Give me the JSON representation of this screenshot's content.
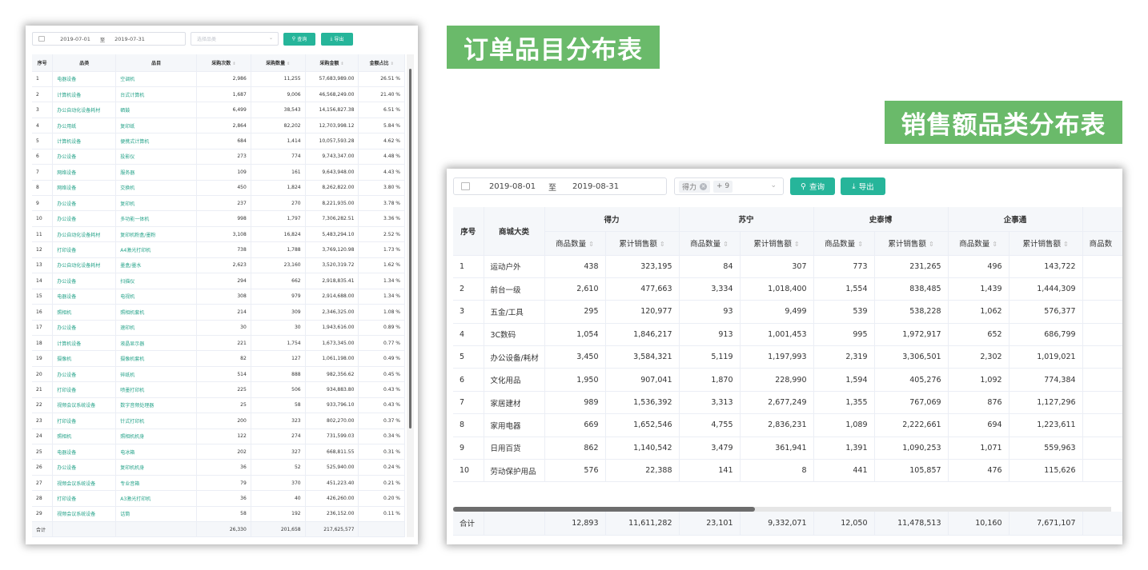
{
  "title1": "订单品目分布表",
  "title2": "销售额品类分布表",
  "left": {
    "date_start": "2019-07-01",
    "date_sep": "至",
    "date_end": "2019-07-31",
    "select_placeholder": "选择品类",
    "query_label": "查询",
    "export_label": "导出",
    "headers": [
      "序号",
      "品类",
      "品目",
      "采购次数",
      "采购数量",
      "采购金额",
      "金额占比"
    ],
    "rows": [
      [
        "1",
        "电器设备",
        "空调机",
        "2,986",
        "11,255",
        "57,683,989.00",
        "26.51 %"
      ],
      [
        "2",
        "计算机设备",
        "台式计算机",
        "1,687",
        "9,006",
        "46,568,249.00",
        "21.40 %"
      ],
      [
        "3",
        "办公自动化设备耗材",
        "硒鼓",
        "6,499",
        "38,543",
        "14,156,827.38",
        "6.51 %"
      ],
      [
        "4",
        "办公用纸",
        "复印纸",
        "2,864",
        "82,202",
        "12,703,998.12",
        "5.84 %"
      ],
      [
        "5",
        "计算机设备",
        "便携式计算机",
        "684",
        "1,414",
        "10,057,593.28",
        "4.62 %"
      ],
      [
        "6",
        "办公设备",
        "投影仪",
        "273",
        "774",
        "9,743,347.00",
        "4.48 %"
      ],
      [
        "7",
        "网络设备",
        "服务器",
        "109",
        "161",
        "9,643,948.00",
        "4.43 %"
      ],
      [
        "8",
        "网络设备",
        "交换机",
        "450",
        "1,824",
        "8,262,822.00",
        "3.80 %"
      ],
      [
        "9",
        "办公设备",
        "复印机",
        "237",
        "270",
        "8,221,935.00",
        "3.78 %"
      ],
      [
        "10",
        "办公设备",
        "多功能一体机",
        "998",
        "1,797",
        "7,306,282.51",
        "3.36 %"
      ],
      [
        "11",
        "办公自动化设备耗材",
        "复印机粉盒/墨粉",
        "3,108",
        "16,824",
        "5,483,294.10",
        "2.52 %"
      ],
      [
        "12",
        "打印设备",
        "A4激光打印机",
        "738",
        "1,788",
        "3,769,120.98",
        "1.73 %"
      ],
      [
        "13",
        "办公自动化设备耗材",
        "墨盒/墨水",
        "2,623",
        "23,160",
        "3,520,319.72",
        "1.62 %"
      ],
      [
        "14",
        "办公设备",
        "扫描仪",
        "294",
        "662",
        "2,918,835.41",
        "1.34 %"
      ],
      [
        "15",
        "电器设备",
        "电视机",
        "308",
        "979",
        "2,914,688.00",
        "1.34 %"
      ],
      [
        "16",
        "照相机",
        "照相机套机",
        "214",
        "309",
        "2,346,325.00",
        "1.08 %"
      ],
      [
        "17",
        "办公设备",
        "速印机",
        "30",
        "30",
        "1,943,616.00",
        "0.89 %"
      ],
      [
        "18",
        "计算机设备",
        "液晶显示器",
        "221",
        "1,754",
        "1,673,345.00",
        "0.77 %"
      ],
      [
        "19",
        "摄像机",
        "摄像机套机",
        "82",
        "127",
        "1,061,198.00",
        "0.49 %"
      ],
      [
        "20",
        "办公设备",
        "碎纸机",
        "514",
        "888",
        "982,356.62",
        "0.45 %"
      ],
      [
        "21",
        "打印设备",
        "喷墨打印机",
        "225",
        "506",
        "934,883.80",
        "0.43 %"
      ],
      [
        "22",
        "视频会议系统设备",
        "数字音频处理器",
        "25",
        "58",
        "933,796.10",
        "0.43 %"
      ],
      [
        "23",
        "打印设备",
        "针式打印机",
        "200",
        "323",
        "802,270.00",
        "0.37 %"
      ],
      [
        "24",
        "照相机",
        "照相机机身",
        "122",
        "274",
        "731,599.03",
        "0.34 %"
      ],
      [
        "25",
        "电器设备",
        "电冰箱",
        "202",
        "327",
        "668,811.55",
        "0.31 %"
      ],
      [
        "26",
        "办公设备",
        "复印机机身",
        "36",
        "52",
        "525,940.00",
        "0.24 %"
      ],
      [
        "27",
        "视频会议系统设备",
        "专业音箱",
        "79",
        "370",
        "451,223.40",
        "0.21 %"
      ],
      [
        "28",
        "打印设备",
        "A3激光打印机",
        "36",
        "40",
        "426,260.00",
        "0.20 %"
      ],
      [
        "29",
        "视频会议系统设备",
        "话筒",
        "58",
        "192",
        "236,152.00",
        "0.11 %"
      ]
    ],
    "sum": [
      "合计",
      "",
      "",
      "26,330",
      "201,658",
      "217,625,577",
      ""
    ]
  },
  "right": {
    "date_start": "2019-08-01",
    "date_sep": "至",
    "date_end": "2019-08-31",
    "tag_label": "得力",
    "tag_more": "+ 9",
    "query_label": "查询",
    "export_label": "导出",
    "col_index": "序号",
    "col_category": "商城大类",
    "groups": [
      "得力",
      "苏宁",
      "史泰博",
      "企事通"
    ],
    "sub_qty": "商品数量",
    "sub_amount": "累计销售额",
    "partial_sub": "商品数",
    "rows": [
      [
        "1",
        "运动户外",
        "438",
        "323,195",
        "84",
        "307",
        "773",
        "231,265",
        "496",
        "143,722"
      ],
      [
        "2",
        "前台一级",
        "2,610",
        "477,663",
        "3,334",
        "1,018,400",
        "1,554",
        "838,485",
        "1,439",
        "1,444,309"
      ],
      [
        "3",
        "五金/工具",
        "295",
        "120,977",
        "93",
        "9,499",
        "539",
        "538,228",
        "1,062",
        "576,377"
      ],
      [
        "4",
        "3C数码",
        "1,054",
        "1,846,217",
        "913",
        "1,001,453",
        "995",
        "1,972,917",
        "652",
        "686,799"
      ],
      [
        "5",
        "办公设备/耗材",
        "3,450",
        "3,584,321",
        "5,119",
        "1,197,993",
        "2,319",
        "3,306,501",
        "2,302",
        "1,019,021"
      ],
      [
        "6",
        "文化用品",
        "1,950",
        "907,041",
        "1,870",
        "228,990",
        "1,594",
        "405,276",
        "1,092",
        "774,384"
      ],
      [
        "7",
        "家居建材",
        "989",
        "1,536,392",
        "3,313",
        "2,677,249",
        "1,355",
        "767,069",
        "876",
        "1,127,296"
      ],
      [
        "8",
        "家用电器",
        "669",
        "1,652,546",
        "4,755",
        "2,836,231",
        "1,089",
        "2,222,661",
        "694",
        "1,223,611"
      ],
      [
        "9",
        "日用百货",
        "862",
        "1,140,542",
        "3,479",
        "361,941",
        "1,391",
        "1,090,253",
        "1,071",
        "559,963"
      ],
      [
        "10",
        "劳动保护用品",
        "576",
        "22,388",
        "141",
        "8",
        "441",
        "105,857",
        "476",
        "115,626"
      ]
    ],
    "sum": [
      "合计",
      "",
      "12,893",
      "11,611,282",
      "23,101",
      "9,332,071",
      "12,050",
      "11,478,513",
      "10,160",
      "7,671,107"
    ]
  }
}
